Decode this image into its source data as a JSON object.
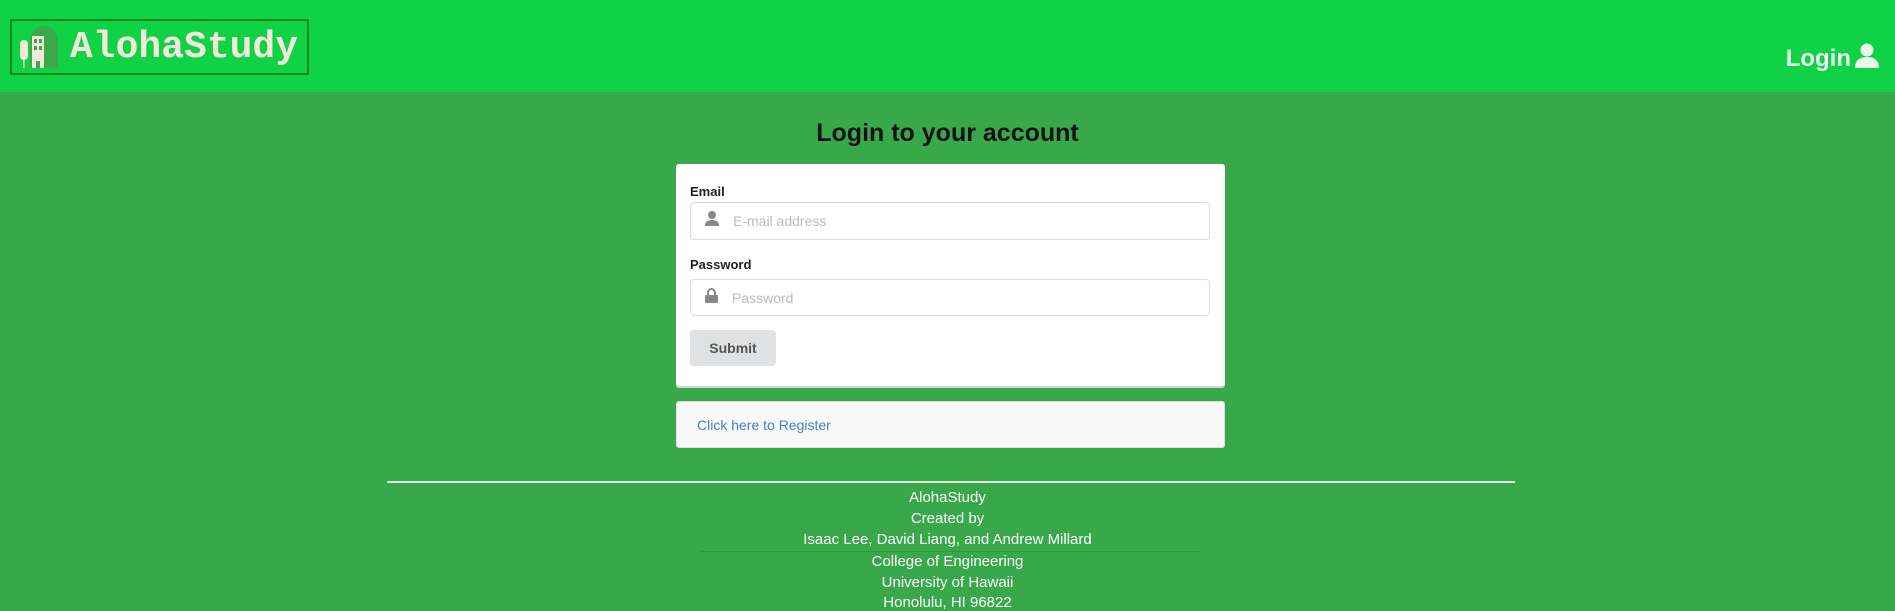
{
  "header": {
    "brand": "AlohaStudy",
    "login_label": "Login"
  },
  "main": {
    "title": "Login to your account",
    "email": {
      "label": "Email",
      "placeholder": "E-mail address",
      "value": ""
    },
    "password": {
      "label": "Password",
      "placeholder": "Password",
      "value": ""
    },
    "submit_label": "Submit",
    "register_link": "Click here to Register"
  },
  "footer": {
    "lines_top": [
      "AlohaStudy",
      "Created by",
      "Isaac Lee, David Liang, and Andrew Millard"
    ],
    "lines_bottom": [
      "College of Engineering",
      "University of Hawaii",
      "Honolulu, HI 96822"
    ]
  },
  "colors": {
    "header": "#10d246",
    "background": "#38a84a",
    "link": "#4183c4"
  }
}
